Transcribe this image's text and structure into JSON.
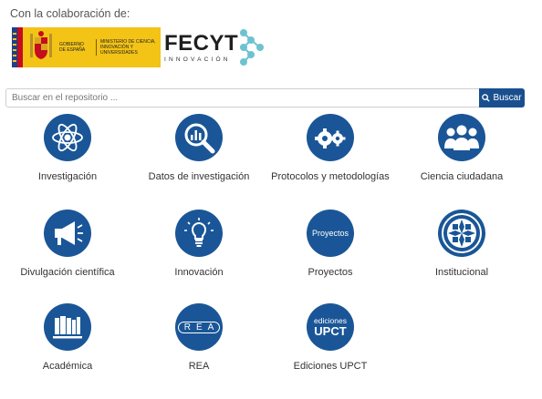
{
  "header": {
    "collab_text": "Con la colaboración de:",
    "gov_logo": {
      "gobierno": "GOBIERNO DE ESPAÑA",
      "ministerio": "MINISTERIO DE CIENCIA, INNOVACIÓN Y UNIVERSIDADES"
    },
    "fecyt_logo": {
      "name": "FECYT",
      "sub": "INNOVACIÓN"
    }
  },
  "search": {
    "placeholder": "Buscar en el repositorio ...",
    "button_label": "Buscar"
  },
  "colors": {
    "accent": "#1a5697",
    "button": "#1a4f8f",
    "fecyt_teal": "#6cc3cf"
  },
  "categories": [
    {
      "label": "Investigación",
      "icon": "atom-icon"
    },
    {
      "label": "Datos de investigación",
      "icon": "magnifier-chart-icon"
    },
    {
      "label": "Protocolos y metodologías",
      "icon": "gears-icon"
    },
    {
      "label": "Ciencia ciudadana",
      "icon": "people-group-icon"
    },
    {
      "label": "Divulgación científica",
      "icon": "megaphone-icon"
    },
    {
      "label": "Innovación",
      "icon": "lightbulb-icon"
    },
    {
      "label": "Proyectos",
      "icon": "proyectos-text-icon",
      "icon_text": "Proyectos"
    },
    {
      "label": "Institucional",
      "icon": "upct-emblem-icon"
    },
    {
      "label": "Académica",
      "icon": "books-icon"
    },
    {
      "label": "REA",
      "icon": "rea-icon",
      "icon_text": "REA"
    },
    {
      "label": "Ediciones UPCT",
      "icon": "ediciones-upct-icon",
      "icon_text_top": "ediciones",
      "icon_text_bottom": "UPCT"
    }
  ]
}
